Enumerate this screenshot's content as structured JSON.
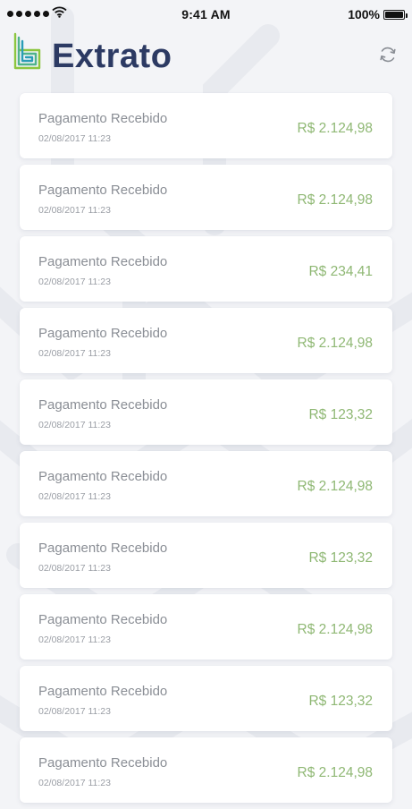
{
  "status_bar": {
    "time": "9:41 AM",
    "battery": "100%"
  },
  "header": {
    "title": "Extrato",
    "logo_icon": "logo-b-icon",
    "refresh_icon": "refresh-icon"
  },
  "colors": {
    "title": "#2c3a63",
    "amount": "#8fb874",
    "label": "#8a8e95",
    "logo_green": "#8cc63f",
    "logo_teal": "#2a9db6"
  },
  "transactions": [
    {
      "label": "Pagamento Recebido",
      "date": "02/08/2017 11:23",
      "amount": "R$ 2.124,98"
    },
    {
      "label": "Pagamento Recebido",
      "date": "02/08/2017 11:23",
      "amount": "R$ 2.124,98"
    },
    {
      "label": "Pagamento Recebido",
      "date": "02/08/2017 11:23",
      "amount": "R$ 234,41"
    },
    {
      "label": "Pagamento Recebido",
      "date": "02/08/2017 11:23",
      "amount": "R$ 2.124,98"
    },
    {
      "label": "Pagamento Recebido",
      "date": "02/08/2017 11:23",
      "amount": "R$ 123,32"
    },
    {
      "label": "Pagamento Recebido",
      "date": "02/08/2017 11:23",
      "amount": "R$ 2.124,98"
    },
    {
      "label": "Pagamento Recebido",
      "date": "02/08/2017 11:23",
      "amount": "R$ 123,32"
    },
    {
      "label": "Pagamento Recebido",
      "date": "02/08/2017 11:23",
      "amount": "R$ 2.124,98"
    },
    {
      "label": "Pagamento Recebido",
      "date": "02/08/2017 11:23",
      "amount": "R$ 123,32"
    },
    {
      "label": "Pagamento Recebido",
      "date": "02/08/2017 11:23",
      "amount": "R$ 2.124,98"
    }
  ]
}
